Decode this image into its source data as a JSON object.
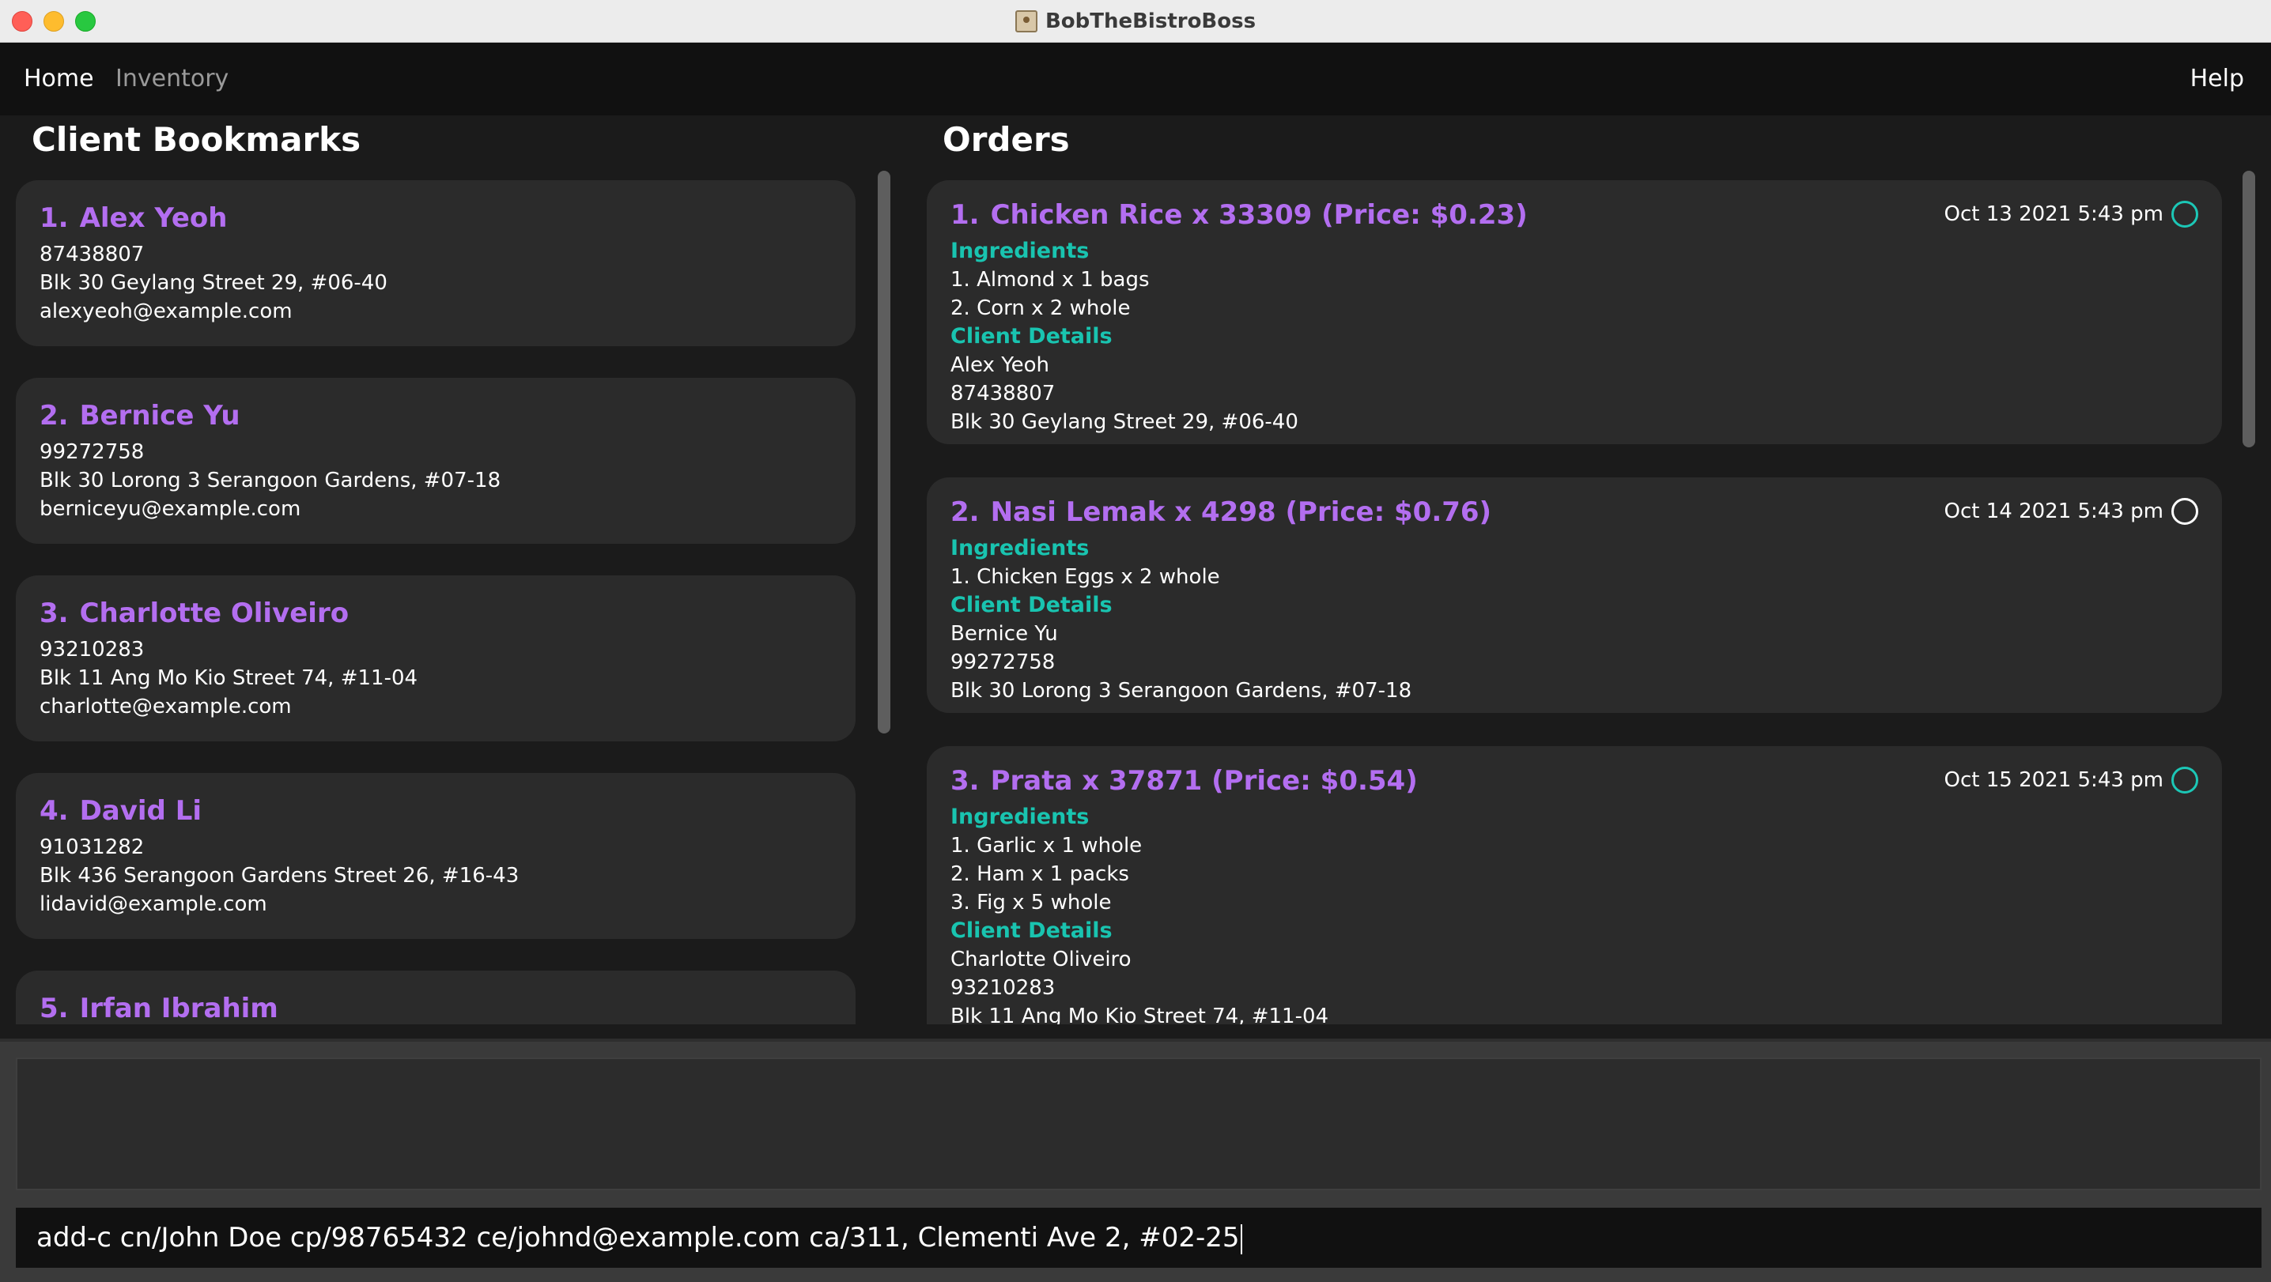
{
  "window": {
    "title": "BobTheBistroBoss"
  },
  "menu": {
    "home": "Home",
    "inventory": "Inventory",
    "help": "Help"
  },
  "left_panel": {
    "title": "Client Bookmarks",
    "clients": [
      {
        "index": "1.",
        "name": "Alex Yeoh",
        "phone": "87438807",
        "address": "Blk 30 Geylang Street 29, #06-40",
        "email": "alexyeoh@example.com"
      },
      {
        "index": "2.",
        "name": "Bernice Yu",
        "phone": "99272758",
        "address": "Blk 30 Lorong 3 Serangoon Gardens, #07-18",
        "email": "berniceyu@example.com"
      },
      {
        "index": "3.",
        "name": "Charlotte Oliveiro",
        "phone": "93210283",
        "address": "Blk 11 Ang Mo Kio Street 74, #11-04",
        "email": "charlotte@example.com"
      },
      {
        "index": "4.",
        "name": "David Li",
        "phone": "91031282",
        "address": "Blk 436 Serangoon Gardens Street 26, #16-43",
        "email": "lidavid@example.com"
      },
      {
        "index": "5.",
        "name": "Irfan Ibrahim"
      }
    ]
  },
  "right_panel": {
    "title": "Orders",
    "ingredients_label": "Ingredients",
    "client_details_label": "Client Details",
    "orders": [
      {
        "index": "1.",
        "title": "Chicken Rice x 33309 (Price: $0.23)",
        "date": "Oct 13 2021 5:43 pm",
        "completed": true,
        "ingredients": [
          "1. Almond x 1 bags",
          "2. Corn x 2 whole"
        ],
        "client": [
          "Alex Yeoh",
          "87438807",
          "Blk 30 Geylang Street 29, #06-40"
        ]
      },
      {
        "index": "2.",
        "title": "Nasi Lemak x 4298 (Price: $0.76)",
        "date": "Oct 14 2021 5:43 pm",
        "completed": false,
        "ingredients": [
          "1. Chicken Eggs x 2 whole"
        ],
        "client": [
          "Bernice Yu",
          "99272758",
          "Blk 30 Lorong 3 Serangoon Gardens, #07-18"
        ]
      },
      {
        "index": "3.",
        "title": "Prata x 37871 (Price: $0.54)",
        "date": "Oct 15 2021 5:43 pm",
        "completed": true,
        "ingredients": [
          "1. Garlic x 1 whole",
          "2. Ham x 1 packs",
          "3. Fig x 5 whole"
        ],
        "client": [
          "Charlotte Oliveiro",
          "93210283",
          "Blk 11 Ang Mo Kio Street 74, #11-04"
        ]
      }
    ]
  },
  "result_display": {
    "text": ""
  },
  "command_box": {
    "value": "add-c cn/John Doe cp/98765432 ce/johnd@example.com ca/311, Clementi Ave 2, #02-25"
  },
  "colors": {
    "accent_purple": "#b36ef0",
    "accent_teal": "#19c4b0",
    "background": "#1b1b1b",
    "card": "#2b2b2b"
  }
}
